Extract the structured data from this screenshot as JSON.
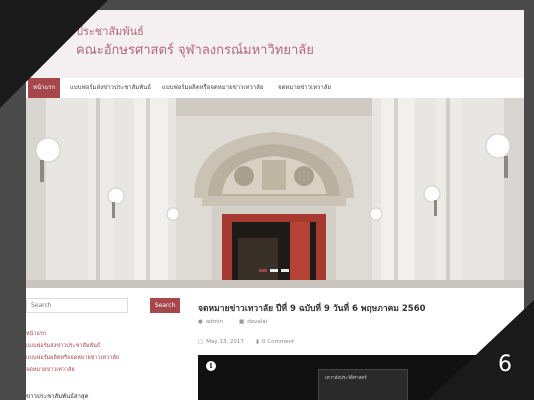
{
  "site": {
    "title": "ประชาสัมพันธ์",
    "subtitle": "คณะอักษรศาสตร์ จุฬาลงกรณ์มหาวิทยาลัย"
  },
  "nav": {
    "items": [
      {
        "label": "หน้าแรก",
        "active": true
      },
      {
        "label": "แบบฟอร์มส่งข่าวประชาสัมพันธ์",
        "active": false
      },
      {
        "label": "แบบฟอร์มผลิตหรือจดหมายข่าวเทวาลัย",
        "active": false
      },
      {
        "label": "จดหมายข่าวเทวาลัย",
        "active": false
      }
    ]
  },
  "hero": {
    "slides": 3,
    "active_slide": 0
  },
  "sidebar": {
    "search_placeholder": "Search",
    "search_button": "Search",
    "links": [
      "หน้าแรก",
      "แบบฟอร์มส่งข่าวประชาสัมพันธ์",
      "แบบฟอร์มผลิตหรือจดหมายข่าวเทวาลัย",
      "จดหมายข่าวเทวาลัย"
    ],
    "next_heading": "ข่าวประชาสัมพันธ์ล่าสุด"
  },
  "post": {
    "title": "จดหมายข่าวเทวาลัย ปีที่ 9 ฉบับที่ 9 วันที่ 6 พฤษภาคม 2560",
    "author": "admin",
    "category": "devalai",
    "date": "May 13, 2017",
    "comments": "0 Comment",
    "video_thumb_text": "เทวาลัยประวัติศาสตร์"
  },
  "slide_number": "6",
  "colors": {
    "accent": "#a6474b",
    "title": "#b2677a",
    "frame": "#4a4a4a",
    "corner": "#1a1a1a"
  }
}
